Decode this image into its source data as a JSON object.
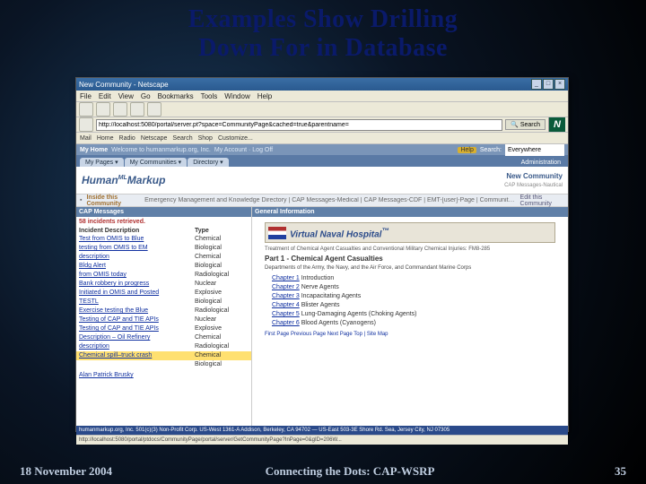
{
  "slide": {
    "title_l1": "Examples Show Drilling",
    "title_l2": "Down For in Database",
    "date": "18 November 2004",
    "center": "Connecting the Dots: CAP-WSRP",
    "page": "35"
  },
  "window": {
    "title": "New Community - Netscape",
    "min": "_",
    "max": "□",
    "close": "×"
  },
  "menus": [
    "File",
    "Edit",
    "View",
    "Go",
    "Bookmarks",
    "Tools",
    "Window",
    "Help"
  ],
  "address": {
    "url": "http://localhost:5080/portal/server.pt?space=CommunityPage&cached=true&parentname=",
    "search_btn": "Search"
  },
  "bookmarks": [
    "Mail",
    "Home",
    "Radio",
    "Netscape",
    "Search",
    "Shop",
    "Customize..."
  ],
  "portal": {
    "myhome": "My Home",
    "welcome": "Welcome to humanmarkup.org, Inc.",
    "account": "My Account · Log Off",
    "help": "Help",
    "search_lbl": "Search:",
    "search_ph": "Everywhere",
    "tabs": [
      "My Pages ▾",
      "My Communities ▾",
      "Directory ▾"
    ],
    "admin": "Administration",
    "logo": "Human",
    "logo_sup": "ML",
    "logo2": "Markup",
    "nc_title": "New Community",
    "nc_sub": "CAP Messages-Nautical",
    "inside_lbl": "Inside this Community",
    "inside_items": "Emergency Management and Knowledge Directory | CAP Messages-Medical | CAP Messages-CDF | EMT-[user]-Page | Community Members and Knowledge Directory",
    "edit": "Edit this Community"
  },
  "cap": {
    "hdr": "CAP Messages",
    "retrieved": "58 incidents retrieved.",
    "col_desc": "Incident Description",
    "col_type": "Type",
    "rows": [
      {
        "d": "Test from OMIS to Blue",
        "t": "Chemical"
      },
      {
        "d": "testing from OMIS to EM",
        "t": "Biological"
      },
      {
        "d": "description",
        "t": "Chemical"
      },
      {
        "d": "Bldg Alert",
        "t": "Biological"
      },
      {
        "d": "from OMIS today",
        "t": "Radiological"
      },
      {
        "d": "Bank robbery in progress",
        "t": "Nuclear"
      },
      {
        "d": "Initiated in OMIS and Posted",
        "t": "Explosive"
      },
      {
        "d": "TESTL",
        "t": "Biological"
      },
      {
        "d": "Exercise testing the Blue",
        "t": "Radiological"
      },
      {
        "d": "Testing of CAP and TIE APIs",
        "t": "Nuclear"
      },
      {
        "d": "Testing of CAP and TIE APIs",
        "t": "Explosive"
      },
      {
        "d": "Description – Oil Refinery",
        "t": "Chemical"
      },
      {
        "d": "description",
        "t": "Radiological"
      },
      {
        "d": "Chemical spill–truck crash",
        "t": "Chemical"
      },
      {
        "d": "",
        "t": "Biological"
      }
    ],
    "sig": "Alan Patrick Brusky"
  },
  "info": {
    "hdr": "General Information",
    "vnh": "Virtual Naval Hospital",
    "tm": "™",
    "docline": "Treatment of Chemical Agent Casualties and Conventional Military Chemical Injuries: FM8-285",
    "part": "Part 1 - Chemical Agent Casualties",
    "dept": "Departments of the Army, the Navy, and the Air Force, and Commandant Marine Corps",
    "chapters": [
      {
        "c": "Chapter 1",
        "t": "Introduction"
      },
      {
        "c": "Chapter 2",
        "t": "Nerve Agents"
      },
      {
        "c": "Chapter 3",
        "t": "Incapacitating Agents"
      },
      {
        "c": "Chapter 4",
        "t": "Blister Agents"
      },
      {
        "c": "Chapter 5",
        "t": "Lung-Damaging Agents (Choking Agents)"
      },
      {
        "c": "Chapter 6",
        "t": "Blood Agents (Cyanogens)"
      }
    ],
    "pager": "First Page  Previous Page  Next Page  Top | Site Map"
  },
  "orgfoot": "humanmarkup.org, Inc. 501(c)(3) Non-Profit Corp. US-West 1361-A Addison, Berkeley, CA 94702 — US-East 503-3E Shore Rd. Sea, Jersey City, NJ 07305",
  "status": "http://localhost:5080/portal/ptdocs/CommunityPage/portal/server/GetCommunityPage?InPage=0&gID=206W..."
}
